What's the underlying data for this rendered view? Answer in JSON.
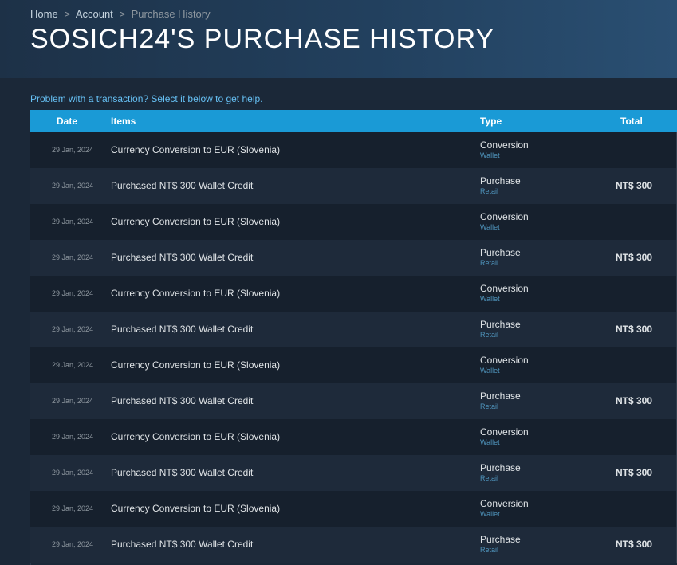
{
  "breadcrumb": {
    "home": "Home",
    "account": "Account",
    "current": "Purchase History",
    "separator": ">"
  },
  "page_title": "SOSICH24'S PURCHASE HISTORY",
  "help_text": "Problem with a transaction? Select it below to get help.",
  "table": {
    "headers": {
      "date": "Date",
      "items": "Items",
      "type": "Type",
      "total": "Total"
    },
    "rows": [
      {
        "date": "29 Jan, 2024",
        "item": "Currency Conversion to EUR (Slovenia)",
        "type": "Conversion",
        "subtype": "Wallet",
        "total": ""
      },
      {
        "date": "29 Jan, 2024",
        "item": "Purchased NT$ 300 Wallet Credit",
        "type": "Purchase",
        "subtype": "Retail",
        "total": "NT$ 300"
      },
      {
        "date": "29 Jan, 2024",
        "item": "Currency Conversion to EUR (Slovenia)",
        "type": "Conversion",
        "subtype": "Wallet",
        "total": ""
      },
      {
        "date": "29 Jan, 2024",
        "item": "Purchased NT$ 300 Wallet Credit",
        "type": "Purchase",
        "subtype": "Retail",
        "total": "NT$ 300"
      },
      {
        "date": "29 Jan, 2024",
        "item": "Currency Conversion to EUR (Slovenia)",
        "type": "Conversion",
        "subtype": "Wallet",
        "total": ""
      },
      {
        "date": "29 Jan, 2024",
        "item": "Purchased NT$ 300 Wallet Credit",
        "type": "Purchase",
        "subtype": "Retail",
        "total": "NT$ 300"
      },
      {
        "date": "29 Jan, 2024",
        "item": "Currency Conversion to EUR (Slovenia)",
        "type": "Conversion",
        "subtype": "Wallet",
        "total": ""
      },
      {
        "date": "29 Jan, 2024",
        "item": "Purchased NT$ 300 Wallet Credit",
        "type": "Purchase",
        "subtype": "Retail",
        "total": "NT$ 300"
      },
      {
        "date": "29 Jan, 2024",
        "item": "Currency Conversion to EUR (Slovenia)",
        "type": "Conversion",
        "subtype": "Wallet",
        "total": ""
      },
      {
        "date": "29 Jan, 2024",
        "item": "Purchased NT$ 300 Wallet Credit",
        "type": "Purchase",
        "subtype": "Retail",
        "total": "NT$ 300"
      },
      {
        "date": "29 Jan, 2024",
        "item": "Currency Conversion to EUR (Slovenia)",
        "type": "Conversion",
        "subtype": "Wallet",
        "total": ""
      },
      {
        "date": "29 Jan, 2024",
        "item": "Purchased NT$ 300 Wallet Credit",
        "type": "Purchase",
        "subtype": "Retail",
        "total": "NT$ 300"
      }
    ]
  },
  "colors": {
    "page_background": "#1b2838",
    "table_header": "#1a9ad6",
    "link": "#66c0f4",
    "subtype": "#4f94bc"
  }
}
